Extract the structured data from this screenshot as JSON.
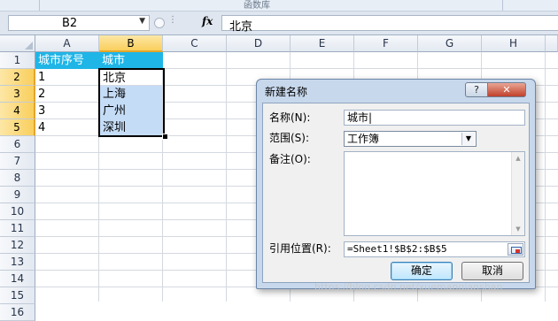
{
  "ribbon": {
    "group_label": "函数库"
  },
  "formula_bar": {
    "name_box": "B2",
    "fx_label": "fx",
    "content": "北京"
  },
  "sheet": {
    "columns": [
      "A",
      "B",
      "C",
      "D",
      "E",
      "F",
      "G",
      "H"
    ],
    "rows": [
      "1",
      "2",
      "3",
      "4",
      "5",
      "6",
      "7",
      "8",
      "9",
      "10",
      "11",
      "12",
      "13",
      "14",
      "15",
      "16"
    ],
    "cells": {
      "A1": "城市序号",
      "B1": "城市",
      "A2": "1",
      "B2": "北京",
      "A3": "2",
      "B3": "上海",
      "A4": "3",
      "B4": "广州",
      "A5": "4",
      "B5": "深圳"
    },
    "header_fill": "#1fb5e7",
    "selection_fill": "#c5dcf6"
  },
  "dialog": {
    "title": "新建名称",
    "help_label": "?",
    "close_label": "✕",
    "name_label": "名称(N):",
    "name_value": "城市|",
    "scope_label": "范围(S):",
    "scope_value": "工作簿",
    "comment_label": "备注(O):",
    "comment_value": "",
    "refers_label": "引用位置(R):",
    "refers_value": "=Sheet1!$B$2:$B$5",
    "ok_label": "确定",
    "cancel_label": "取消"
  },
  "watermark": "https://blog.csdn.net/xuemanqianshan"
}
